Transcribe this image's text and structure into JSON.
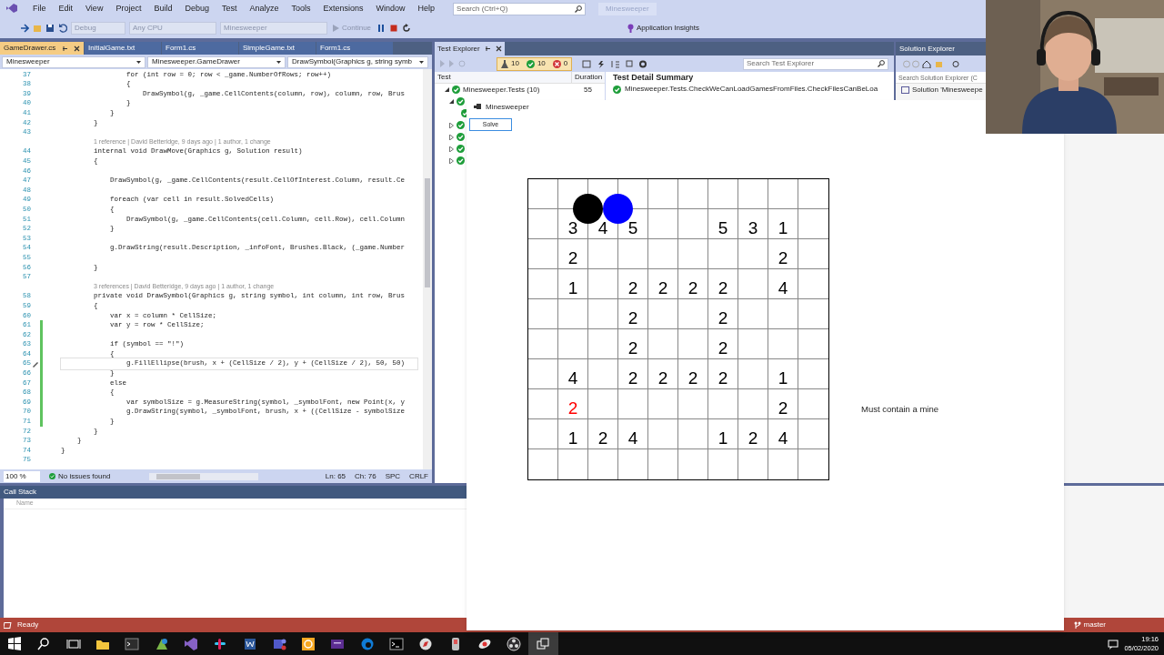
{
  "menu": {
    "items": [
      "File",
      "Edit",
      "View",
      "Project",
      "Build",
      "Debug",
      "Test",
      "Analyze",
      "Tools",
      "Extensions",
      "Window",
      "Help"
    ],
    "search_placeholder": "Search (Ctrl+Q)",
    "solution_title": "Minesweeper"
  },
  "toolbar": {
    "configuration": "Debug",
    "platform": "Any CPU",
    "startup_project": "Minesweeper",
    "continue": "Continue",
    "insights": "Application Insights"
  },
  "editor": {
    "tabs": [
      {
        "label": "GameDrawer.cs",
        "selected": true
      },
      {
        "label": "InitialGame.txt",
        "selected": false
      },
      {
        "label": "Form1.cs",
        "selected": false
      },
      {
        "label": "SimpleGame.txt",
        "selected": false
      },
      {
        "label": "Form1.cs",
        "selected": false
      }
    ],
    "nav": [
      "Minesweeper",
      "Minesweeper.GameDrawer",
      "DrawSymbol(Graphics g, string symb"
    ],
    "lines": [
      {
        "kind": "code",
        "number": "37",
        "code": "                for (int row = 0; row < _game.NumberOfRows; row++)",
        "changed": false,
        "current": false
      },
      {
        "kind": "code",
        "number": "38",
        "code": "                {",
        "changed": false,
        "current": false
      },
      {
        "kind": "code",
        "number": "39",
        "code": "                    DrawSymbol(g, _game.CellContents(column, row), column, row, Brus",
        "changed": false,
        "current": false
      },
      {
        "kind": "code",
        "number": "40",
        "code": "                }",
        "changed": false,
        "current": false
      },
      {
        "kind": "code",
        "number": "41",
        "code": "            }",
        "changed": false,
        "current": false
      },
      {
        "kind": "code",
        "number": "42",
        "code": "        }",
        "changed": false,
        "current": false
      },
      {
        "kind": "code",
        "number": "43",
        "changed": false,
        "current": false
      },
      {
        "kind": "codelens",
        "text": "1 reference | David Betteridge, 9 days ago | 1 author, 1 change"
      },
      {
        "kind": "code",
        "number": "44",
        "code": "        internal void DrawMove(Graphics g, Solution result)",
        "changed": false,
        "current": false
      },
      {
        "kind": "code",
        "number": "45",
        "code": "        {",
        "changed": false,
        "current": false
      },
      {
        "kind": "code",
        "number": "46",
        "changed": false,
        "current": false
      },
      {
        "kind": "code",
        "number": "47",
        "code": "            DrawSymbol(g, _game.CellContents(result.CellOfInterest.Column, result.Ce",
        "changed": false,
        "current": false
      },
      {
        "kind": "code",
        "number": "48",
        "changed": false,
        "current": false
      },
      {
        "kind": "code",
        "number": "49",
        "code": "            foreach (var cell in result.SolvedCells)",
        "changed": false,
        "current": false
      },
      {
        "kind": "code",
        "number": "50",
        "code": "            {",
        "changed": false,
        "current": false
      },
      {
        "kind": "code",
        "number": "51",
        "code": "                DrawSymbol(g, _game.CellContents(cell.Column, cell.Row), cell.Column",
        "changed": false,
        "current": false
      },
      {
        "kind": "code",
        "number": "52",
        "code": "            }",
        "changed": false,
        "current": false
      },
      {
        "kind": "code",
        "number": "53",
        "changed": false,
        "current": false
      },
      {
        "kind": "code",
        "number": "54",
        "code": "            g.DrawString(result.Description, _infoFont, Brushes.Black, (_game.Number",
        "changed": false,
        "current": false
      },
      {
        "kind": "code",
        "number": "55",
        "changed": false,
        "current": false
      },
      {
        "kind": "code",
        "number": "56",
        "code": "        }",
        "changed": false,
        "current": false
      },
      {
        "kind": "code",
        "number": "57",
        "changed": false,
        "current": false
      },
      {
        "kind": "codelens",
        "text": "3 references | David Betteridge, 9 days ago | 1 author, 1 change"
      },
      {
        "kind": "code",
        "number": "58",
        "code": "        private void DrawSymbol(Graphics g, string symbol, int column, int row, Brus",
        "changed": false,
        "current": false
      },
      {
        "kind": "code",
        "number": "59",
        "code": "        {",
        "changed": false,
        "current": false
      },
      {
        "kind": "code",
        "number": "60",
        "code": "            var x = column * CellSize;",
        "changed": false,
        "current": false
      },
      {
        "kind": "code",
        "number": "61",
        "code": "            var y = row * CellSize;",
        "changed": true,
        "current": false
      },
      {
        "kind": "code",
        "number": "62",
        "changed": true,
        "current": false
      },
      {
        "kind": "code",
        "number": "63",
        "code": "            if (symbol == \"!\")",
        "changed": true,
        "current": false
      },
      {
        "kind": "code",
        "number": "64",
        "code": "            {",
        "changed": true,
        "current": false
      },
      {
        "kind": "code",
        "number": "65",
        "code": "                g.FillEllipse(brush, x + (CellSize / 2), y + (CellSize / 2), 50, 50)",
        "changed": true,
        "current": true
      },
      {
        "kind": "code",
        "number": "66",
        "code": "            }",
        "changed": true,
        "current": false
      },
      {
        "kind": "code",
        "number": "67",
        "code": "            else",
        "changed": true,
        "current": false
      },
      {
        "kind": "code",
        "number": "68",
        "code": "            {",
        "changed": true,
        "current": false
      },
      {
        "kind": "code",
        "number": "69",
        "code": "                var symbolSize = g.MeasureString(symbol, _symbolFont, new Point(x, y",
        "changed": true,
        "current": false
      },
      {
        "kind": "code",
        "number": "70",
        "code": "                g.DrawString(symbol, _symbolFont, brush, x + ((CellSize - symbolSize",
        "changed": true,
        "current": false
      },
      {
        "kind": "code",
        "number": "71",
        "code": "            }",
        "changed": true,
        "current": false
      },
      {
        "kind": "code",
        "number": "72",
        "code": "        }",
        "changed": false,
        "current": false
      },
      {
        "kind": "code",
        "number": "73",
        "code": "    }",
        "changed": false,
        "current": false
      },
      {
        "kind": "code",
        "number": "74",
        "code": "}",
        "changed": false,
        "current": false
      },
      {
        "kind": "code",
        "number": "75",
        "changed": false,
        "current": false
      }
    ],
    "status": {
      "zoom": "100 %",
      "issues": "No issues found",
      "line": "Ln: 65",
      "column": "Ch: 76",
      "spacing": "SPC",
      "line_ending": "CRLF"
    }
  },
  "test_explorer": {
    "title": "Test Explorer",
    "counts": {
      "total": "10",
      "passed": "10",
      "failed": "0"
    },
    "search_placeholder": "Search Test Explorer",
    "columns": [
      "Test",
      "Duration"
    ],
    "tree": [
      {
        "label": "Minesweeper.Tests (10)",
        "duration": "55",
        "passed": true,
        "expanded": true,
        "children": [
          {
            "passed": true,
            "expanded": true,
            "children": [
              {
                "passed": true
              }
            ]
          },
          {
            "passed": true,
            "expanded": false
          },
          {
            "passed": true,
            "expanded": false
          },
          {
            "passed": true,
            "expanded": false
          },
          {
            "passed": true,
            "expanded": false
          }
        ]
      }
    ],
    "detail": {
      "title": "Test Detail Summary",
      "test": "Minesweeper.Tests.CheckWeCanLoadGamesFromFiles.CheckFilesCanBeLoa",
      "passed": true
    }
  },
  "solution_explorer": {
    "title": "Solution Explorer",
    "search_placeholder": "Search Solution Explorer (C",
    "root": "Solution 'Minesweepe"
  },
  "call_stack": {
    "title": "Call Stack",
    "columns": [
      "Name"
    ]
  },
  "minesweeper": {
    "title": "Minesweeper",
    "solve_button": "Solve",
    "message": "Must contain a mine",
    "board": [
      [
        {
          "kind": "empty"
        },
        {
          "kind": "marker",
          "color": "#000000"
        },
        {
          "kind": "marker",
          "color": "#0000ff"
        },
        {
          "kind": "empty"
        },
        {
          "kind": "empty"
        },
        {
          "kind": "empty"
        },
        {
          "kind": "empty"
        },
        {
          "kind": "empty"
        },
        {
          "kind": "empty"
        },
        {
          "kind": "empty"
        }
      ],
      [
        {
          "kind": "empty"
        },
        {
          "kind": "number",
          "text": "3",
          "color": "#000000"
        },
        {
          "kind": "number",
          "text": "4",
          "color": "#000000"
        },
        {
          "kind": "number",
          "text": "5",
          "color": "#000000"
        },
        {
          "kind": "empty"
        },
        {
          "kind": "empty"
        },
        {
          "kind": "number",
          "text": "5",
          "color": "#000000"
        },
        {
          "kind": "number",
          "text": "3",
          "color": "#000000"
        },
        {
          "kind": "number",
          "text": "1",
          "color": "#000000"
        },
        {
          "kind": "empty"
        }
      ],
      [
        {
          "kind": "empty"
        },
        {
          "kind": "number",
          "text": "2",
          "color": "#000000"
        },
        {
          "kind": "empty"
        },
        {
          "kind": "empty"
        },
        {
          "kind": "empty"
        },
        {
          "kind": "empty"
        },
        {
          "kind": "empty"
        },
        {
          "kind": "empty"
        },
        {
          "kind": "number",
          "text": "2",
          "color": "#000000"
        },
        {
          "kind": "empty"
        }
      ],
      [
        {
          "kind": "empty"
        },
        {
          "kind": "number",
          "text": "1",
          "color": "#000000"
        },
        {
          "kind": "empty"
        },
        {
          "kind": "number",
          "text": "2",
          "color": "#000000"
        },
        {
          "kind": "number",
          "text": "2",
          "color": "#000000"
        },
        {
          "kind": "number",
          "text": "2",
          "color": "#000000"
        },
        {
          "kind": "number",
          "text": "2",
          "color": "#000000"
        },
        {
          "kind": "empty"
        },
        {
          "kind": "number",
          "text": "4",
          "color": "#000000"
        },
        {
          "kind": "empty"
        }
      ],
      [
        {
          "kind": "empty"
        },
        {
          "kind": "empty"
        },
        {
          "kind": "empty"
        },
        {
          "kind": "number",
          "text": "2",
          "color": "#000000"
        },
        {
          "kind": "empty"
        },
        {
          "kind": "empty"
        },
        {
          "kind": "number",
          "text": "2",
          "color": "#000000"
        },
        {
          "kind": "empty"
        },
        {
          "kind": "empty"
        },
        {
          "kind": "empty"
        }
      ],
      [
        {
          "kind": "empty"
        },
        {
          "kind": "empty"
        },
        {
          "kind": "empty"
        },
        {
          "kind": "number",
          "text": "2",
          "color": "#000000"
        },
        {
          "kind": "empty"
        },
        {
          "kind": "empty"
        },
        {
          "kind": "number",
          "text": "2",
          "color": "#000000"
        },
        {
          "kind": "empty"
        },
        {
          "kind": "empty"
        },
        {
          "kind": "empty"
        }
      ],
      [
        {
          "kind": "empty"
        },
        {
          "kind": "number",
          "text": "4",
          "color": "#000000"
        },
        {
          "kind": "empty"
        },
        {
          "kind": "number",
          "text": "2",
          "color": "#000000"
        },
        {
          "kind": "number",
          "text": "2",
          "color": "#000000"
        },
        {
          "kind": "number",
          "text": "2",
          "color": "#000000"
        },
        {
          "kind": "number",
          "text": "2",
          "color": "#000000"
        },
        {
          "kind": "empty"
        },
        {
          "kind": "number",
          "text": "1",
          "color": "#000000"
        },
        {
          "kind": "empty"
        }
      ],
      [
        {
          "kind": "empty"
        },
        {
          "kind": "number",
          "text": "2",
          "color": "#ff0000"
        },
        {
          "kind": "empty"
        },
        {
          "kind": "empty"
        },
        {
          "kind": "empty"
        },
        {
          "kind": "empty"
        },
        {
          "kind": "empty"
        },
        {
          "kind": "empty"
        },
        {
          "kind": "number",
          "text": "2",
          "color": "#000000"
        },
        {
          "kind": "empty"
        }
      ],
      [
        {
          "kind": "empty"
        },
        {
          "kind": "number",
          "text": "1",
          "color": "#000000"
        },
        {
          "kind": "number",
          "text": "2",
          "color": "#000000"
        },
        {
          "kind": "number",
          "text": "4",
          "color": "#000000"
        },
        {
          "kind": "empty"
        },
        {
          "kind": "empty"
        },
        {
          "kind": "number",
          "text": "1",
          "color": "#000000"
        },
        {
          "kind": "number",
          "text": "2",
          "color": "#000000"
        },
        {
          "kind": "number",
          "text": "4",
          "color": "#000000"
        },
        {
          "kind": "empty"
        }
      ],
      [
        {
          "kind": "empty"
        },
        {
          "kind": "empty"
        },
        {
          "kind": "empty"
        },
        {
          "kind": "empty"
        },
        {
          "kind": "empty"
        },
        {
          "kind": "empty"
        },
        {
          "kind": "empty"
        },
        {
          "kind": "empty"
        },
        {
          "kind": "empty"
        },
        {
          "kind": "empty"
        }
      ]
    ]
  },
  "status_bar": {
    "text": "Ready",
    "branch": "master"
  },
  "taskbar": {
    "time": "19:16",
    "date": "05/02/2020"
  }
}
